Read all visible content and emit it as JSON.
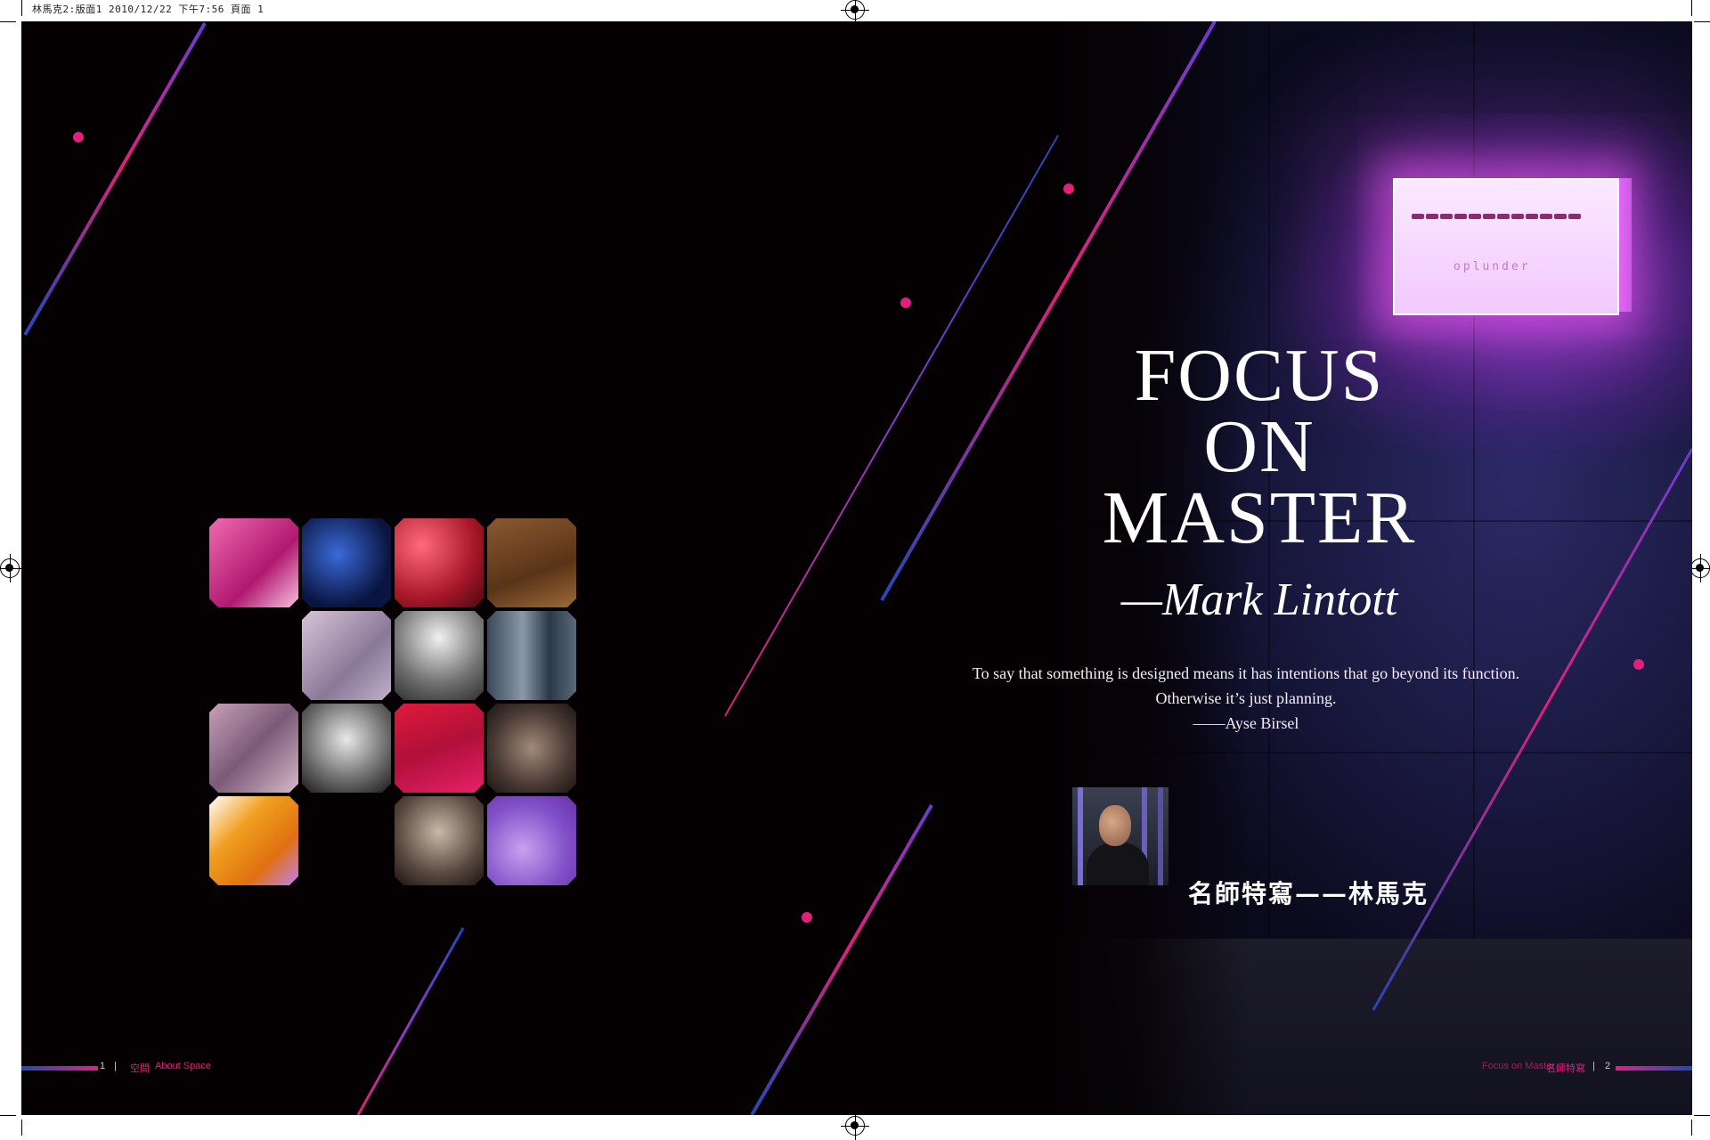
{
  "slug": {
    "text": "林馬克2:版面1  2010/12/22  下午7:56  頁面 1"
  },
  "spread": {
    "title_lines": [
      "FOCUS",
      "ON",
      "MASTER"
    ],
    "byline": "—Mark Lintott",
    "quote": {
      "line1": "To say that something is designed means it has intentions that go beyond its function.",
      "line2": "Otherwise it’s just planning.",
      "attribution": "——Ayse Birsel"
    },
    "zh_title": "名師特寫——林馬克",
    "sign_sub": "oplunder"
  },
  "footer": {
    "left_page_number": "1",
    "left_section": "空間",
    "left_magazine": "About Space",
    "right_magazine": "Focus on Master",
    "right_section": "名師特寫",
    "right_page_number": "2"
  },
  "colors": {
    "background": "#050103",
    "accent_pink": "#e0207a",
    "accent_blue": "#2447b8",
    "text": "#ffffff"
  }
}
